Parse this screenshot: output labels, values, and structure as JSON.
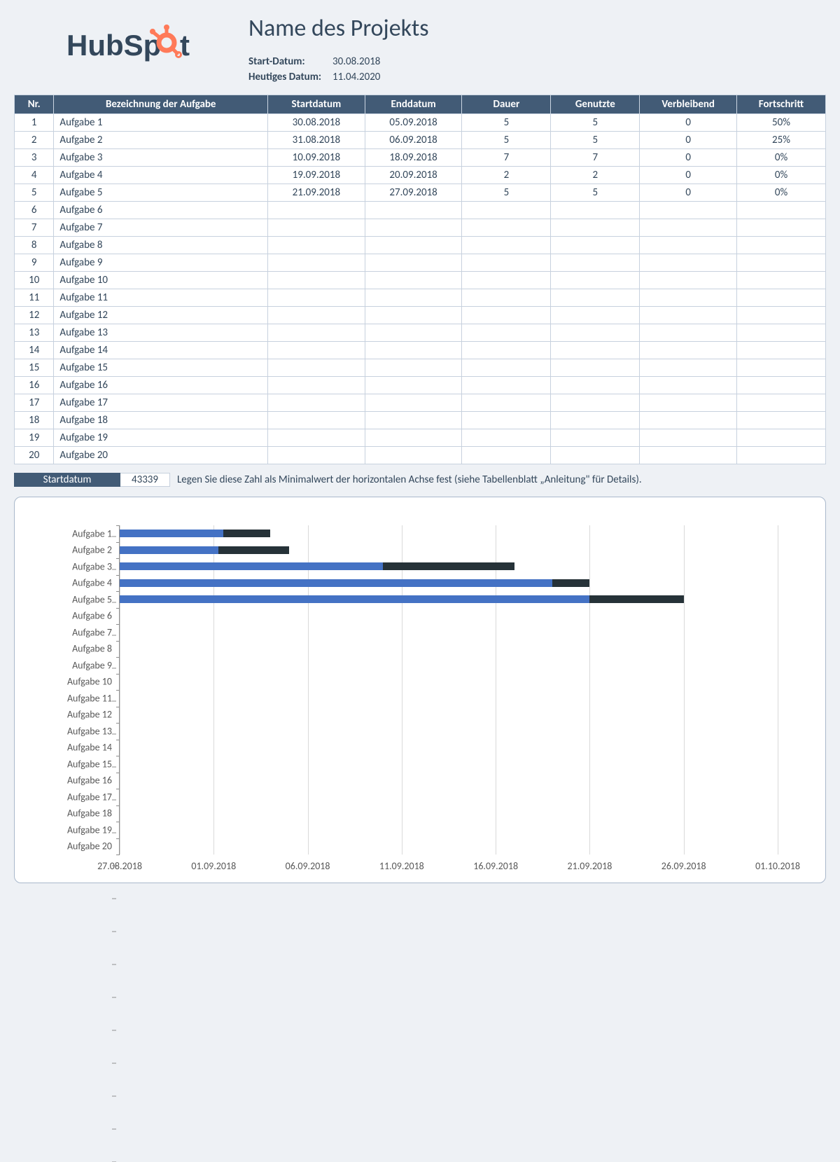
{
  "header": {
    "logo_text": "HubSpot",
    "title": "Name des Projekts",
    "start_label": "Start-Datum:",
    "start_value": "30.08.2018",
    "today_label": "Heutiges Datum:",
    "today_value": "11.04.2020"
  },
  "table": {
    "columns": [
      "Nr.",
      "Bezeichnung der Aufgabe",
      "Startdatum",
      "Enddatum",
      "Dauer",
      "Genutzte",
      "Verbleibend",
      "Fortschritt"
    ],
    "rows": [
      {
        "nr": "1",
        "name": "Aufgabe 1",
        "start": "30.08.2018",
        "end": "05.09.2018",
        "dur": "5",
        "used": "5",
        "rem": "0",
        "prog": "50%"
      },
      {
        "nr": "2",
        "name": "Aufgabe 2",
        "start": "31.08.2018",
        "end": "06.09.2018",
        "dur": "5",
        "used": "5",
        "rem": "0",
        "prog": "25%"
      },
      {
        "nr": "3",
        "name": "Aufgabe 3",
        "start": "10.09.2018",
        "end": "18.09.2018",
        "dur": "7",
        "used": "7",
        "rem": "0",
        "prog": "0%"
      },
      {
        "nr": "4",
        "name": "Aufgabe 4",
        "start": "19.09.2018",
        "end": "20.09.2018",
        "dur": "2",
        "used": "2",
        "rem": "0",
        "prog": "0%"
      },
      {
        "nr": "5",
        "name": "Aufgabe 5",
        "start": "21.09.2018",
        "end": "27.09.2018",
        "dur": "5",
        "used": "5",
        "rem": "0",
        "prog": "0%"
      },
      {
        "nr": "6",
        "name": "Aufgabe 6",
        "start": "",
        "end": "",
        "dur": "",
        "used": "",
        "rem": "",
        "prog": ""
      },
      {
        "nr": "7",
        "name": "Aufgabe 7",
        "start": "",
        "end": "",
        "dur": "",
        "used": "",
        "rem": "",
        "prog": ""
      },
      {
        "nr": "8",
        "name": "Aufgabe 8",
        "start": "",
        "end": "",
        "dur": "",
        "used": "",
        "rem": "",
        "prog": ""
      },
      {
        "nr": "9",
        "name": "Aufgabe 9",
        "start": "",
        "end": "",
        "dur": "",
        "used": "",
        "rem": "",
        "prog": ""
      },
      {
        "nr": "10",
        "name": "Aufgabe 10",
        "start": "",
        "end": "",
        "dur": "",
        "used": "",
        "rem": "",
        "prog": ""
      },
      {
        "nr": "11",
        "name": "Aufgabe 11",
        "start": "",
        "end": "",
        "dur": "",
        "used": "",
        "rem": "",
        "prog": ""
      },
      {
        "nr": "12",
        "name": "Aufgabe 12",
        "start": "",
        "end": "",
        "dur": "",
        "used": "",
        "rem": "",
        "prog": ""
      },
      {
        "nr": "13",
        "name": "Aufgabe 13",
        "start": "",
        "end": "",
        "dur": "",
        "used": "",
        "rem": "",
        "prog": ""
      },
      {
        "nr": "14",
        "name": "Aufgabe 14",
        "start": "",
        "end": "",
        "dur": "",
        "used": "",
        "rem": "",
        "prog": ""
      },
      {
        "nr": "15",
        "name": "Aufgabe 15",
        "start": "",
        "end": "",
        "dur": "",
        "used": "",
        "rem": "",
        "prog": ""
      },
      {
        "nr": "16",
        "name": "Aufgabe 16",
        "start": "",
        "end": "",
        "dur": "",
        "used": "",
        "rem": "",
        "prog": ""
      },
      {
        "nr": "17",
        "name": "Aufgabe 17",
        "start": "",
        "end": "",
        "dur": "",
        "used": "",
        "rem": "",
        "prog": ""
      },
      {
        "nr": "18",
        "name": "Aufgabe 18",
        "start": "",
        "end": "",
        "dur": "",
        "used": "",
        "rem": "",
        "prog": ""
      },
      {
        "nr": "19",
        "name": "Aufgabe 19",
        "start": "",
        "end": "",
        "dur": "",
        "used": "",
        "rem": "",
        "prog": ""
      },
      {
        "nr": "20",
        "name": "Aufgabe 20",
        "start": "",
        "end": "",
        "dur": "",
        "used": "",
        "rem": "",
        "prog": ""
      }
    ]
  },
  "axis_hint": {
    "label": "Startdatum",
    "value": "43339",
    "text": "Legen Sie diese Zahl als Minimalwert der horizontalen Achse fest (siehe Tabellenblatt „Anleitung\" für Details)."
  },
  "chart_data": {
    "type": "bar",
    "orientation": "horizontal",
    "x_min_serial": 43339,
    "x_max_serial": 43374,
    "x_ticks": [
      {
        "label": "27.08.2018",
        "serial": 43339
      },
      {
        "label": "01.09.2018",
        "serial": 43344
      },
      {
        "label": "06.09.2018",
        "serial": 43349
      },
      {
        "label": "11.09.2018",
        "serial": 43354
      },
      {
        "label": "16.09.2018",
        "serial": 43359
      },
      {
        "label": "21.09.2018",
        "serial": 43364
      },
      {
        "label": "26.09.2018",
        "serial": 43369
      },
      {
        "label": "01.10.2018",
        "serial": 43374
      }
    ],
    "categories": [
      "Aufgabe 1",
      "Aufgabe 2",
      "Aufgabe 3",
      "Aufgabe 4",
      "Aufgabe 5",
      "Aufgabe 6",
      "Aufgabe 7",
      "Aufgabe 8",
      "Aufgabe 9",
      "Aufgabe 10",
      "Aufgabe 11",
      "Aufgabe 12",
      "Aufgabe 13",
      "Aufgabe 14",
      "Aufgabe 15",
      "Aufgabe 16",
      "Aufgabe 17",
      "Aufgabe 18",
      "Aufgabe 19",
      "Aufgabe 20"
    ],
    "series": [
      {
        "name": "offset",
        "role": "invisible-stack",
        "color": "transparent",
        "values": [
          3,
          4,
          14,
          23,
          25,
          null,
          null,
          null,
          null,
          null,
          null,
          null,
          null,
          null,
          null,
          null,
          null,
          null,
          null,
          null
        ]
      },
      {
        "name": "completed",
        "color": "#4472c4",
        "values": [
          2.5,
          1.25,
          0,
          0,
          0,
          null,
          null,
          null,
          null,
          null,
          null,
          null,
          null,
          null,
          null,
          null,
          null,
          null,
          null,
          null
        ]
      },
      {
        "name": "remaining",
        "color": "#263238",
        "values": [
          2.5,
          3.75,
          7,
          2,
          5,
          null,
          null,
          null,
          null,
          null,
          null,
          null,
          null,
          null,
          null,
          null,
          null,
          null,
          null,
          null
        ]
      }
    ]
  }
}
